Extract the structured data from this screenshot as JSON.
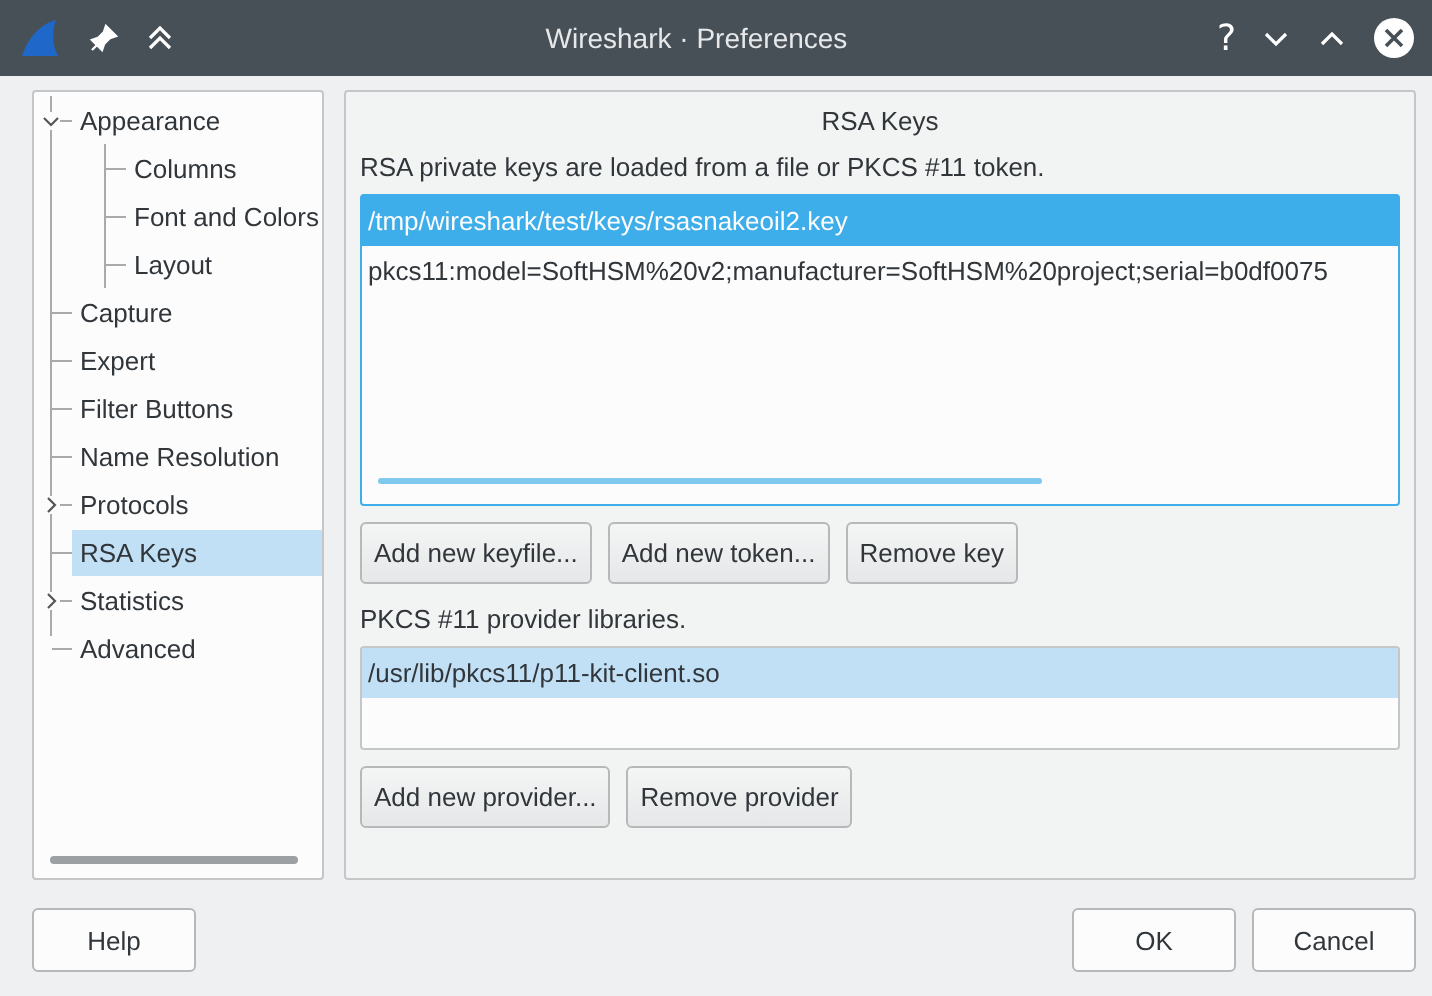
{
  "window": {
    "title": "Wireshark · Preferences",
    "controls": [
      "?"
    ]
  },
  "sidebar": {
    "items": [
      {
        "label": "Appearance",
        "kind": "group",
        "expanded": true,
        "selected": false,
        "children": [
          {
            "label": "Columns",
            "selected": false
          },
          {
            "label": "Font and Colors",
            "selected": false
          },
          {
            "label": "Layout",
            "selected": false
          }
        ]
      },
      {
        "label": "Capture",
        "kind": "leaf",
        "selected": false
      },
      {
        "label": "Expert",
        "kind": "leaf",
        "selected": false
      },
      {
        "label": "Filter Buttons",
        "kind": "leaf",
        "selected": false
      },
      {
        "label": "Name Resolution",
        "kind": "leaf",
        "selected": false
      },
      {
        "label": "Protocols",
        "kind": "group",
        "expanded": false,
        "selected": false
      },
      {
        "label": "RSA Keys",
        "kind": "leaf",
        "selected": true
      },
      {
        "label": "Statistics",
        "kind": "group",
        "expanded": false,
        "selected": false
      },
      {
        "label": "Advanced",
        "kind": "leaf",
        "selected": false
      }
    ]
  },
  "panel": {
    "title": "RSA Keys",
    "keys_label": "RSA private keys are loaded from a file or PKCS #11 token.",
    "keys": [
      {
        "text": "/tmp/wireshark/test/keys/rsasnakeoil2.key",
        "selected": true
      },
      {
        "text": "pkcs11:model=SoftHSM%20v2;manufacturer=SoftHSM%20project;serial=b0df0075",
        "selected": false
      }
    ],
    "key_buttons": [
      "Add new keyfile...",
      "Add new token...",
      "Remove key"
    ],
    "providers_label": "PKCS #11 provider libraries.",
    "providers": [
      {
        "text": "/usr/lib/pkcs11/p11-kit-client.so",
        "selected": true
      }
    ],
    "provider_buttons": [
      "Add new provider...",
      "Remove provider"
    ]
  },
  "buttons": {
    "help": "Help",
    "ok": "OK",
    "cancel": "Cancel"
  }
}
